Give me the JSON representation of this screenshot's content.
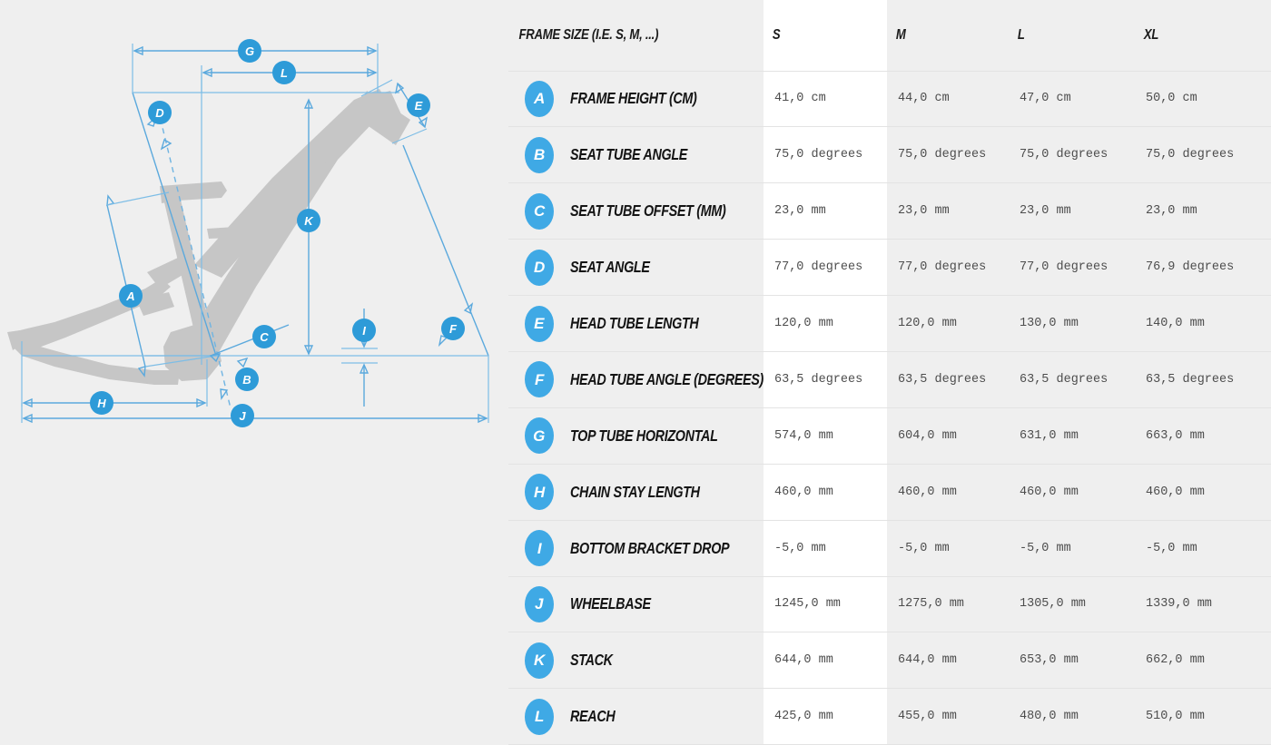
{
  "table": {
    "header": {
      "label_column": "FRAME SIZE (I.E. S, M, ...)",
      "sizes": [
        "S",
        "M",
        "L",
        "XL"
      ]
    },
    "rows": [
      {
        "badge": "A",
        "label": "FRAME HEIGHT (CM)",
        "S": "41,0 cm",
        "M": "44,0 cm",
        "L": "47,0 cm",
        "XL": "50,0 cm"
      },
      {
        "badge": "B",
        "label": "SEAT TUBE ANGLE",
        "S": "75,0 degrees",
        "M": "75,0 degrees",
        "L": "75,0 degrees",
        "XL": "75,0 degrees"
      },
      {
        "badge": "C",
        "label": "SEAT TUBE OFFSET (MM)",
        "S": "23,0 mm",
        "M": "23,0 mm",
        "L": "23,0 mm",
        "XL": "23,0 mm"
      },
      {
        "badge": "D",
        "label": "SEAT ANGLE",
        "S": "77,0 degrees",
        "M": "77,0 degrees",
        "L": "77,0 degrees",
        "XL": "76,9 degrees"
      },
      {
        "badge": "E",
        "label": "HEAD TUBE LENGTH",
        "S": "120,0 mm",
        "M": "120,0 mm",
        "L": "130,0 mm",
        "XL": "140,0 mm"
      },
      {
        "badge": "F",
        "label": "HEAD TUBE ANGLE (DEGREES)",
        "S": "63,5 degrees",
        "M": "63,5 degrees",
        "L": "63,5 degrees",
        "XL": "63,5 degrees"
      },
      {
        "badge": "G",
        "label": "TOP TUBE HORIZONTAL",
        "S": "574,0 mm",
        "M": "604,0 mm",
        "L": "631,0 mm",
        "XL": "663,0 mm"
      },
      {
        "badge": "H",
        "label": "CHAIN STAY LENGTH",
        "S": "460,0 mm",
        "M": "460,0 mm",
        "L": "460,0 mm",
        "XL": "460,0 mm"
      },
      {
        "badge": "I",
        "label": "BOTTOM BRACKET DROP",
        "S": "-5,0 mm",
        "M": "-5,0 mm",
        "L": "-5,0 mm",
        "XL": "-5,0 mm"
      },
      {
        "badge": "J",
        "label": "WHEELBASE",
        "S": "1245,0 mm",
        "M": "1275,0 mm",
        "L": "1305,0 mm",
        "XL": "1339,0 mm"
      },
      {
        "badge": "K",
        "label": "STACK",
        "S": "644,0 mm",
        "M": "644,0 mm",
        "L": "653,0 mm",
        "XL": "662,0 mm"
      },
      {
        "badge": "L",
        "label": "REACH",
        "S": "425,0 mm",
        "M": "455,0 mm",
        "L": "480,0 mm",
        "XL": "510,0 mm"
      }
    ]
  },
  "diagram": {
    "title": "bicycle-frame-geometry-diagram",
    "markers": [
      "A",
      "B",
      "C",
      "D",
      "E",
      "F",
      "G",
      "H",
      "I",
      "J",
      "K",
      "L"
    ],
    "colors": {
      "accent": "#3fa9e5",
      "dimension_line": "#5ba9dd",
      "frame_silhouette": "#c6c6c6",
      "page_background": "#efefef",
      "highlight_column": "#ffffff"
    }
  }
}
